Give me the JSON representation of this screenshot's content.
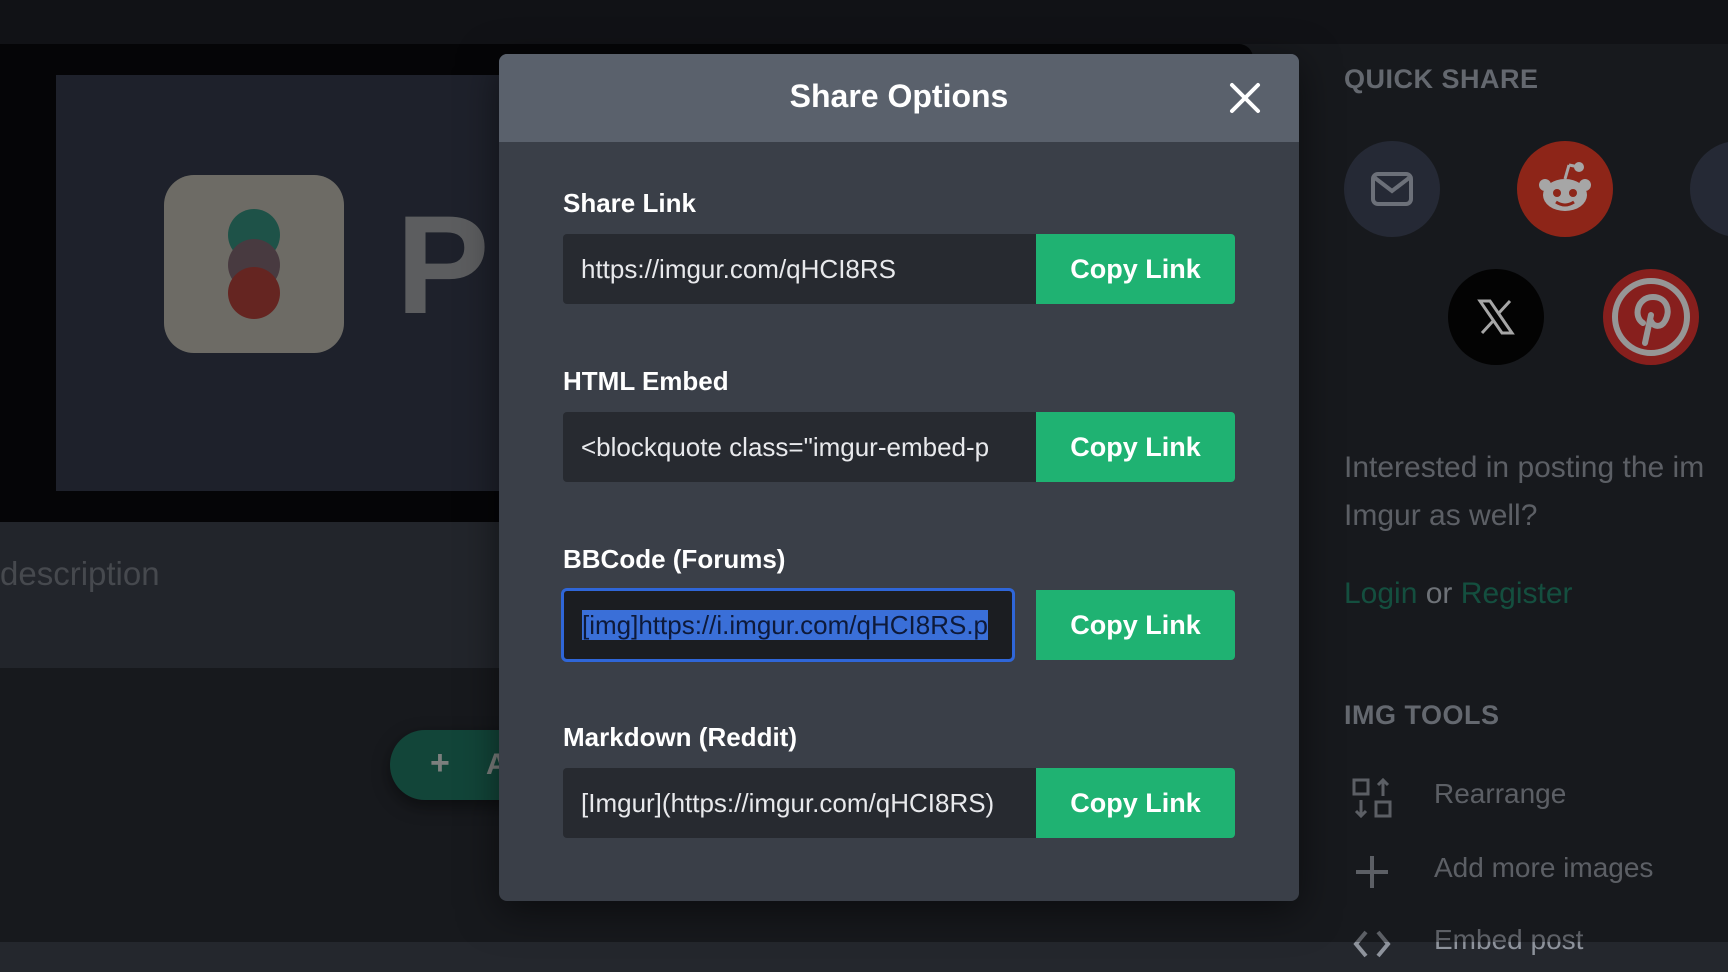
{
  "background": {
    "post_logo_letter": "P",
    "description_placeholder": "description",
    "add_button_letter": "A"
  },
  "sidebar": {
    "quick_share_title": "QUICK SHARE",
    "quick_share_icons": [
      "email-icon",
      "reddit-icon",
      "x-icon",
      "pinterest-icon"
    ],
    "posting_prompt_line1": "Interested in posting the im",
    "posting_prompt_line2": "Imgur as well?",
    "login_label": "Login",
    "or_label": "or",
    "register_label": "Register",
    "img_tools_title": "IMG TOOLS",
    "tools": [
      {
        "label": "Rearrange",
        "icon": "rearrange-icon"
      },
      {
        "label": "Add more images",
        "icon": "plus-icon"
      },
      {
        "label": "Embed post",
        "icon": "code-icon"
      }
    ]
  },
  "modal": {
    "title": "Share Options",
    "fields": [
      {
        "label": "Share Link",
        "value": "https://imgur.com/qHCI8RS",
        "button": "Copy Link"
      },
      {
        "label": "HTML Embed",
        "value": "<blockquote class=\"imgur-embed-p",
        "button": "Copy Link"
      },
      {
        "label": "BBCode (Forums)",
        "value": "[img]https://i.imgur.com/qHCI8RS.p",
        "button": "Copy Link"
      },
      {
        "label": "Markdown (Reddit)",
        "value": "[Imgur](https://imgur.com/qHCI8RS)",
        "button": "Copy Link"
      }
    ]
  },
  "colors": {
    "accent_green": "#1fb272",
    "focus_blue": "#2f66d8",
    "reddit_red": "#d93a26",
    "pinterest_red": "#d0312d"
  }
}
